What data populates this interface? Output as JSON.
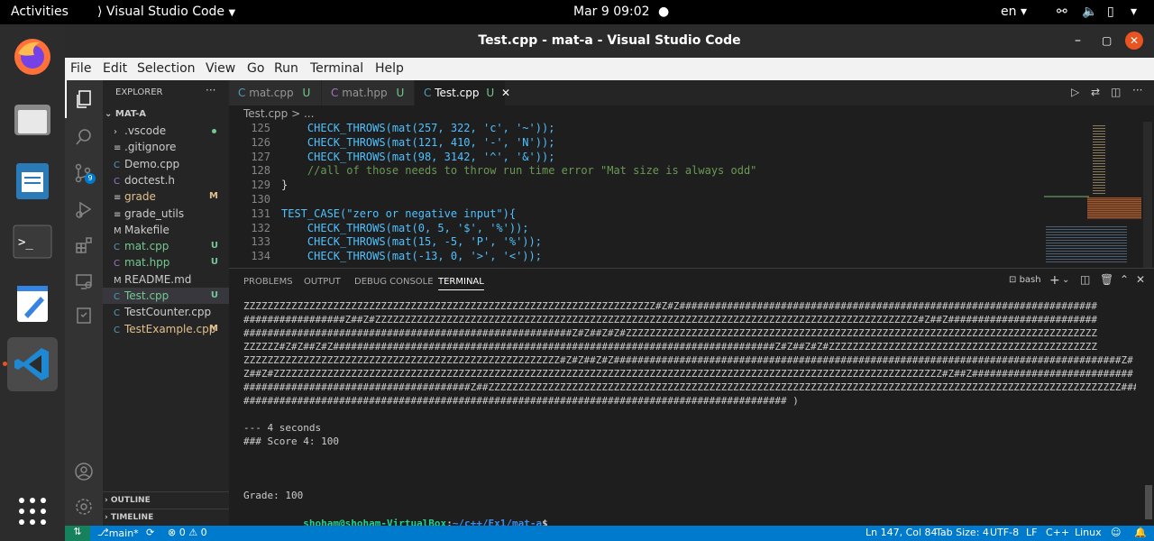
{
  "topbar": {
    "activities": "Activities",
    "app": "Visual Studio Code",
    "clock": "Mar 9  09:02",
    "lang": "en"
  },
  "window": {
    "title": "Test.cpp - mat-a - Visual Studio Code"
  },
  "menu": [
    "File",
    "Edit",
    "Selection",
    "View",
    "Go",
    "Run",
    "Terminal",
    "Help"
  ],
  "explorer": {
    "header": "EXPLORER",
    "folder": "MAT-A",
    "files": [
      {
        "name": ".vscode",
        "badge": "",
        "color": "#cccccc"
      },
      {
        "name": ".gitignore",
        "badge": "",
        "color": "#cccccc"
      },
      {
        "name": "Demo.cpp",
        "badge": "",
        "color": "#cccccc"
      },
      {
        "name": "doctest.h",
        "badge": "",
        "color": "#cccccc"
      },
      {
        "name": "grade",
        "badge": "M",
        "color": "#e2c08d"
      },
      {
        "name": "grade_utils",
        "badge": "",
        "color": "#cccccc"
      },
      {
        "name": "Makefile",
        "badge": "",
        "color": "#cccccc"
      },
      {
        "name": "mat.cpp",
        "badge": "U",
        "color": "#73c991"
      },
      {
        "name": "mat.hpp",
        "badge": "U",
        "color": "#73c991"
      },
      {
        "name": "README.md",
        "badge": "",
        "color": "#cccccc"
      },
      {
        "name": "Test.cpp",
        "badge": "U",
        "color": "#73c991"
      },
      {
        "name": "TestCounter.cpp",
        "badge": "",
        "color": "#cccccc"
      },
      {
        "name": "TestExample.cpp",
        "badge": "M",
        "color": "#e2c08d"
      }
    ],
    "outline": "OUTLINE",
    "timeline": "TIMELINE"
  },
  "tabs": [
    {
      "label": "mat.cpp",
      "mark": "U"
    },
    {
      "label": "mat.hpp",
      "mark": "U"
    },
    {
      "label": "Test.cpp",
      "mark": "U"
    }
  ],
  "breadcrumb": "Test.cpp > ...",
  "code": [
    {
      "n": "125",
      "t": "    CHECK_THROWS(mat(257, 322, 'c', '~'));"
    },
    {
      "n": "126",
      "t": "    CHECK_THROWS(mat(121, 410, '-', 'N'));"
    },
    {
      "n": "127",
      "t": "    CHECK_THROWS(mat(98, 3142, '^', '&'));"
    },
    {
      "n": "128",
      "t": "    //all of those needs to throw run time error \"Mat size is always odd\""
    },
    {
      "n": "129",
      "t": "}"
    },
    {
      "n": "130",
      "t": ""
    },
    {
      "n": "131",
      "t": "TEST_CASE(\"zero or negative input\"){"
    },
    {
      "n": "132",
      "t": "    CHECK_THROWS(mat(0, 5, '$', '%'));"
    },
    {
      "n": "133",
      "t": "    CHECK_THROWS(mat(15, -5, 'P', '%'));"
    },
    {
      "n": "134",
      "t": "    CHECK_THROWS(mat(-13, 0, '>', '<'));"
    }
  ],
  "panel_tabs": [
    "PROBLEMS",
    "OUTPUT",
    "DEBUG CONSOLE",
    "TERMINAL"
  ],
  "terminal_shell": "bash",
  "terminal": [
    "ZZZZZZZZZZZZZZZZZZZZZZZZZZZZZZZZZZZZZZZZZZZZZZZZZZZZZZZZZZZZZZZZZZZZZ#Z#Z######################################################################",
    "#################Z##Z#ZZZZZZZZZZZZZZZZZZZZZZZZZZZZZZZZZZZZZZZZZZZZZZZZZZZZZZZZZZZZZZZZZZZZZZZZZZZZZZZZZZZZZZZZZZZ#Z##Z#########################",
    "#######################################################Z#Z##Z#Z#ZZZZZZZZZZZZZZZZZZZZZZZZZZZZZZZZZZZZZZZZZZZZZZZZZZZZZZZZZZZZZZZZZZZZZZZZZZZZZZZ",
    "ZZZZZZ#Z#Z##Z#Z##########################################################################Z#Z##Z#Z#ZZZZZZZZZZZZZZZZZZZZZZZZZZZZZZZZZZZZZZZZZZZZZ",
    "ZZZZZZZZZZZZZZZZZZZZZZZZZZZZZZZZZZZZZZZZZZZZZZZZZZZZZ#Z#Z##Z#Z#####################################################################################Z#",
    "Z##Z#ZZZZZZZZZZZZZZZZZZZZZZZZZZZZZZZZZZZZZZZZZZZZZZZZZZZZZZZZZZZZZZZZZZZZZZZZZZZZZZZZZZZZZZZZZZZZZZZZZZZZZZZZZZZZZZZZ#Z##Z###########################",
    "######################################Z##ZZZZZZZZZZZZZZZZZZZZZZZZZZZZZZZZZZZZZZZZZZZZZZZZZZZZZZZZZZZZZZZZZZZZZZZZZZZZZZZZZZZZZZZZZZZZZZZZZZZZZZZZZZ#######",
    "########################################################################################### )",
    "",
    "--- 4 seconds",
    "### Score 4: 100",
    "",
    "",
    "",
    "Grade: 100"
  ],
  "prompt": {
    "user": "shoham@shoham-VirtualBox",
    "path": "~/c++/Ex1/mat-a",
    "symbol": "$"
  },
  "status": {
    "branch": "main*",
    "problems": "⊗ 0 ⚠ 0",
    "position": "Ln 147, Col 84",
    "tabsize": "Tab Size: 4",
    "encoding": "UTF-8",
    "eol": "LF",
    "language": "C++",
    "platform": "Linux"
  },
  "colors": {
    "accent": "#007acc",
    "ubuntu_orange": "#e95420",
    "keyword": "#4ec9b0",
    "string": "#ce9178",
    "comment": "#6a9955"
  }
}
